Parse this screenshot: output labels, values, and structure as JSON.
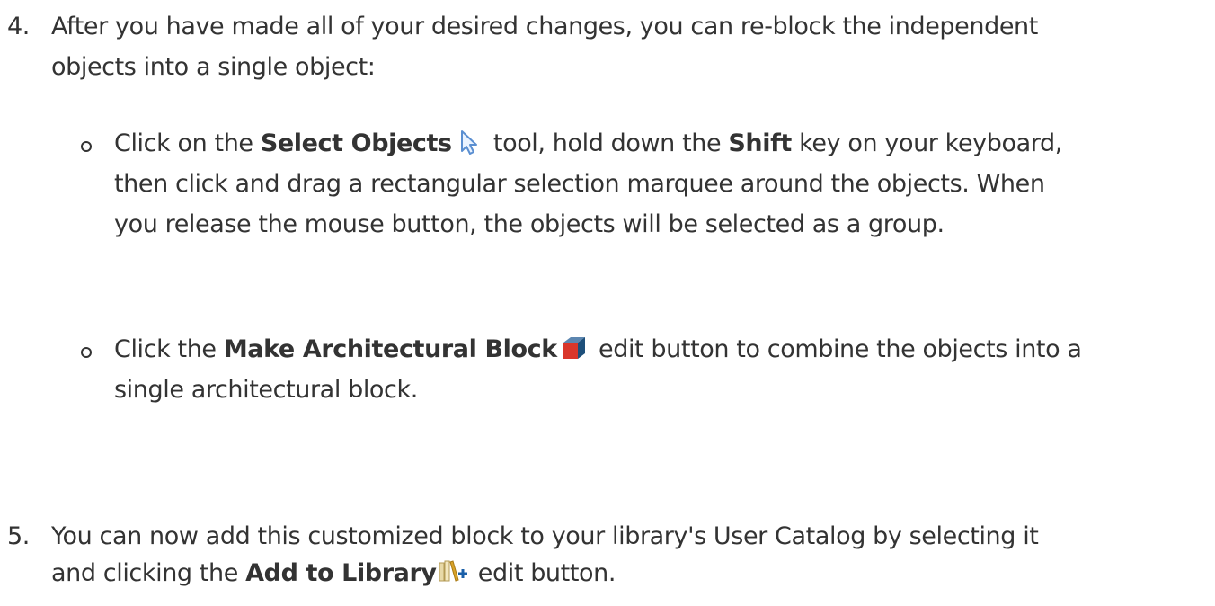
{
  "steps": [
    {
      "number": "4.",
      "line1": "After you have made all of your desired changes, you can re-block the independent",
      "line2": "objects into a single object:",
      "substeps": [
        {
          "prefix": "Click on the ",
          "bold1": "Select Objects",
          "icon": "select-objects-arrow-icon",
          "middle": " tool, hold down the ",
          "bold2": "Shift",
          "suffix": " key on your keyboard,",
          "line2": "then click and drag a rectangular selection marquee around the objects. When",
          "line3": "you release the mouse button, the objects will be selected as a group."
        },
        {
          "prefix": "Click the ",
          "bold1": "Make Architectural Block",
          "icon": "architectural-block-cube-icon",
          "suffix": " edit button to combine the objects into a",
          "line2": "single architectural block."
        }
      ]
    },
    {
      "number": "5.",
      "line1": "You can now add this customized block to your library's User Catalog by selecting it",
      "prefix2": "and clicking the ",
      "bold": "Add to Library",
      "icon": "add-to-library-icon",
      "suffix2": " edit button."
    }
  ],
  "colors": {
    "text": "#333333",
    "cube_red": "#d9362b",
    "cube_blue": "#1d4f7a",
    "arrow_blue": "#5b8fd1",
    "library_gold": "#d8a32a",
    "plus_blue": "#1a5fa8"
  }
}
